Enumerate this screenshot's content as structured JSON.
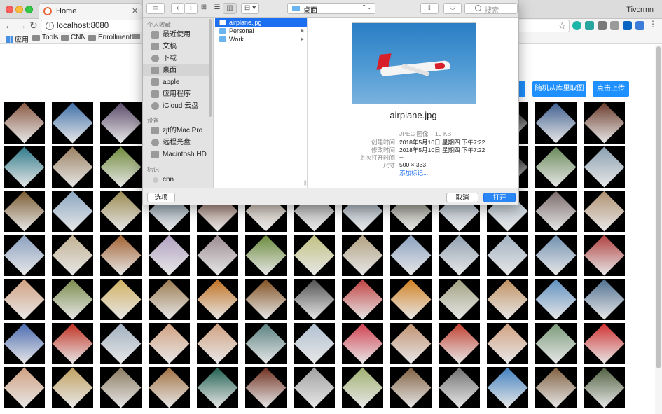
{
  "browser": {
    "tab_title": "Home",
    "tab_close": "✕",
    "profile_name": "Tivcrmn",
    "url": "localhost:8080",
    "info_glyph": "i",
    "nav": {
      "back": "←",
      "forward": "→",
      "reload": "↻"
    },
    "star": "☆",
    "extension_colors": [
      "#1cb5a8",
      "#2aa6a0",
      "#7a7a7a",
      "#9a9a9a",
      "#0a66c2",
      "#3b7dd8",
      "#555555"
    ],
    "bookmarks": [
      "应用",
      "Tools",
      "CNN",
      "Enrollment"
    ]
  },
  "page": {
    "buttons": {
      "random": "随机从库里取图",
      "upload": "点击上传"
    },
    "accent_color": "#1e90ff",
    "tile_colors": [
      [
        "#8a5a44",
        "#3f6fa8",
        "#5a4a6a",
        "#000000",
        "#000000",
        "#000000",
        "#000000",
        "#000000",
        "#000000",
        "#000000",
        "#000000",
        "#3f5f8f",
        "#6a3a2a"
      ],
      [
        "#2f7a8a",
        "#9a8060",
        "#6f8a3a",
        "#000000",
        "#000000",
        "#000000",
        "#000000",
        "#000000",
        "#000000",
        "#000000",
        "#000000",
        "#6a8a5a",
        "#8aa0b0"
      ],
      [
        "#7a5a30",
        "#8aa6c0",
        "#9a8a50",
        "#7a90a0",
        "#8a6050",
        "#c0b0a0",
        "#a0a0a0",
        "#90a0b0",
        "#808070",
        "#a0b0c0",
        "#b0c0d0",
        "#7a6a6a",
        "#b09070"
      ],
      [
        "#8aa0c0",
        "#c0b090",
        "#a06030",
        "#b0a0c0",
        "#9a8a90",
        "#6a8a3a",
        "#c0c080",
        "#b0a080",
        "#8aa0c0",
        "#90a0b0",
        "#a0b0c0",
        "#7090b0",
        "#b04040"
      ],
      [
        "#d0a080",
        "#7a8a4a",
        "#d0b060",
        "#9a7a50",
        "#c07020",
        "#805020",
        "#505050",
        "#c04040",
        "#d08020",
        "#a0a080",
        "#c09060",
        "#6090c0",
        "#507090"
      ],
      [
        "#4a6ab0",
        "#c03020",
        "#a0b0c0",
        "#d0a080",
        "#d0a080",
        "#5a8080",
        "#b0c0d0",
        "#d04050",
        "#c09070",
        "#c04030",
        "#d0a080",
        "#7a9a7a",
        "#d03030"
      ],
      [
        "#d0a080",
        "#c0a060",
        "#8a7a60",
        "#a07040",
        "#206050",
        "#703020",
        "#a0a0a0",
        "#a0b070",
        "#806040",
        "#707070",
        "#4080c0",
        "#806040",
        "#506040"
      ]
    ]
  },
  "dialog": {
    "location": "桌面",
    "search_placeholder": "搜索",
    "sidebar": {
      "favorites_header": "个人收藏",
      "favorites": [
        "最近使用",
        "文稿",
        "下载",
        "桌面",
        "apple",
        "应用程序",
        "iCloud 云盘"
      ],
      "devices_header": "设备",
      "devices": [
        "zjt的Mac Pro",
        "远程光盘",
        "Macintosh HD"
      ],
      "tags_header": "标记",
      "tags": [
        "cnn"
      ]
    },
    "files": [
      {
        "name": "airplane.jpg",
        "type": "file",
        "selected": true
      },
      {
        "name": "Personal",
        "type": "folder",
        "selected": false
      },
      {
        "name": "Work",
        "type": "folder",
        "selected": false
      }
    ],
    "folder_arrow": "▸",
    "resize_grip": "||",
    "preview": {
      "name": "airplane.jpg",
      "kind": "JPEG 图像 – 10 KB",
      "created_label": "创建时间",
      "created": "2018年5月10日 星期四 下午7:22",
      "modified_label": "修改时间",
      "modified": "2018年5月10日 星期四 下午7:22",
      "opened_label": "上次打开时间",
      "opened": "--",
      "size_label": "尺寸",
      "size": "500 × 333",
      "add_tags": "添加标记..."
    },
    "buttons": {
      "options": "选项",
      "cancel": "取消",
      "open": "打开"
    },
    "toolbar_glyphs": {
      "sidebar": "▭",
      "back": "‹",
      "forward": "›",
      "icons": "⊞",
      "list": "☰",
      "columns": "▥",
      "gallery": "⊟ ▾",
      "share": "⇪",
      "tag": "⬭",
      "chevrons": "⌃⌄"
    }
  }
}
